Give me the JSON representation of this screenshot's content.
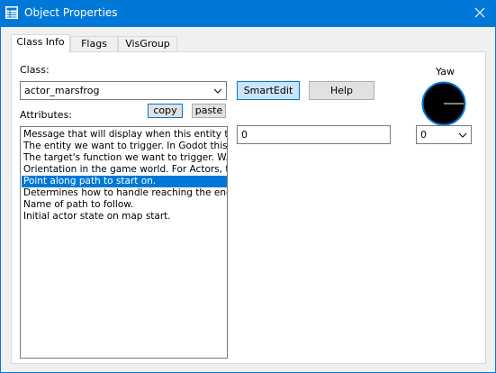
{
  "window": {
    "title": "Object Properties",
    "icon": "properties-grid-icon",
    "close_icon": "close-icon"
  },
  "tabs": [
    {
      "label": "Class Info",
      "active": true
    },
    {
      "label": "Flags",
      "active": false
    },
    {
      "label": "VisGroup",
      "active": false
    }
  ],
  "class": {
    "label": "Class:",
    "value": "actor_marsfrog"
  },
  "buttons": {
    "smartedit": "SmartEdit",
    "help": "Help",
    "copy": "copy",
    "paste": "paste"
  },
  "attributes": {
    "label": "Attributes:",
    "items": [
      "Message that will display when this entity tri...",
      "The entity we want to trigger. In Godot this ...",
      "The target's function we want to trigger. WA...",
      "Orientation in the game world. For Actors, t...",
      "Point along path to start on.",
      "Determines how to handle reaching the end ...",
      "Name of path to follow.",
      "Initial actor state on map start."
    ],
    "selected_index": 4
  },
  "value_field": {
    "value": "0"
  },
  "yaw": {
    "label": "Yaw",
    "value": "0"
  },
  "colors": {
    "accent": "#0078d7",
    "selection": "#0078d7",
    "face": "#f0f0f0"
  }
}
